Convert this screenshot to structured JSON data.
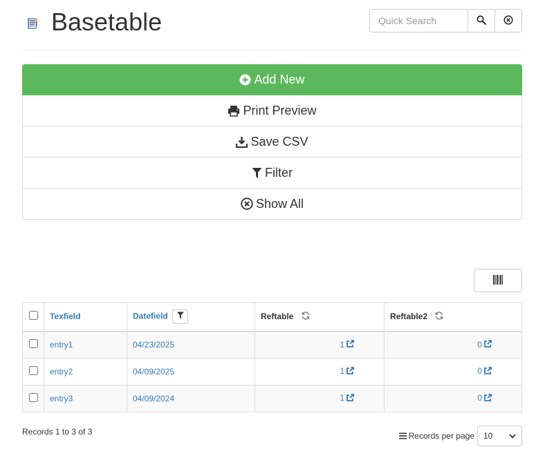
{
  "header": {
    "title": "Basetable",
    "search": {
      "placeholder": "Quick Search",
      "value": ""
    }
  },
  "actions": [
    {
      "label": "Add New",
      "icon": "plus-circle-icon",
      "style": "primary"
    },
    {
      "label": "Print Preview",
      "icon": "print-icon"
    },
    {
      "label": "Save CSV",
      "icon": "download-icon"
    },
    {
      "label": "Filter",
      "icon": "filter-icon"
    },
    {
      "label": "Show All",
      "icon": "times-circle-icon"
    }
  ],
  "table": {
    "columns": [
      "Texfield",
      "Datefield",
      "Reftable",
      "Reftable2"
    ],
    "rows": [
      {
        "text": "entry1",
        "date": "04/23/2025",
        "ref": "1",
        "ref2": "0"
      },
      {
        "text": "entry2",
        "date": "04/09/2025",
        "ref": "1",
        "ref2": "0"
      },
      {
        "text": "entry3",
        "date": "04/09/2024",
        "ref": "1",
        "ref2": "0"
      }
    ]
  },
  "footer": {
    "records_info": "Records 1 to 3 of 3",
    "per_page_label": "Records per page",
    "per_page_value": "10"
  },
  "colors": {
    "primary": "#5cb85c",
    "link": "#337ab7",
    "border": "#dddddd"
  }
}
